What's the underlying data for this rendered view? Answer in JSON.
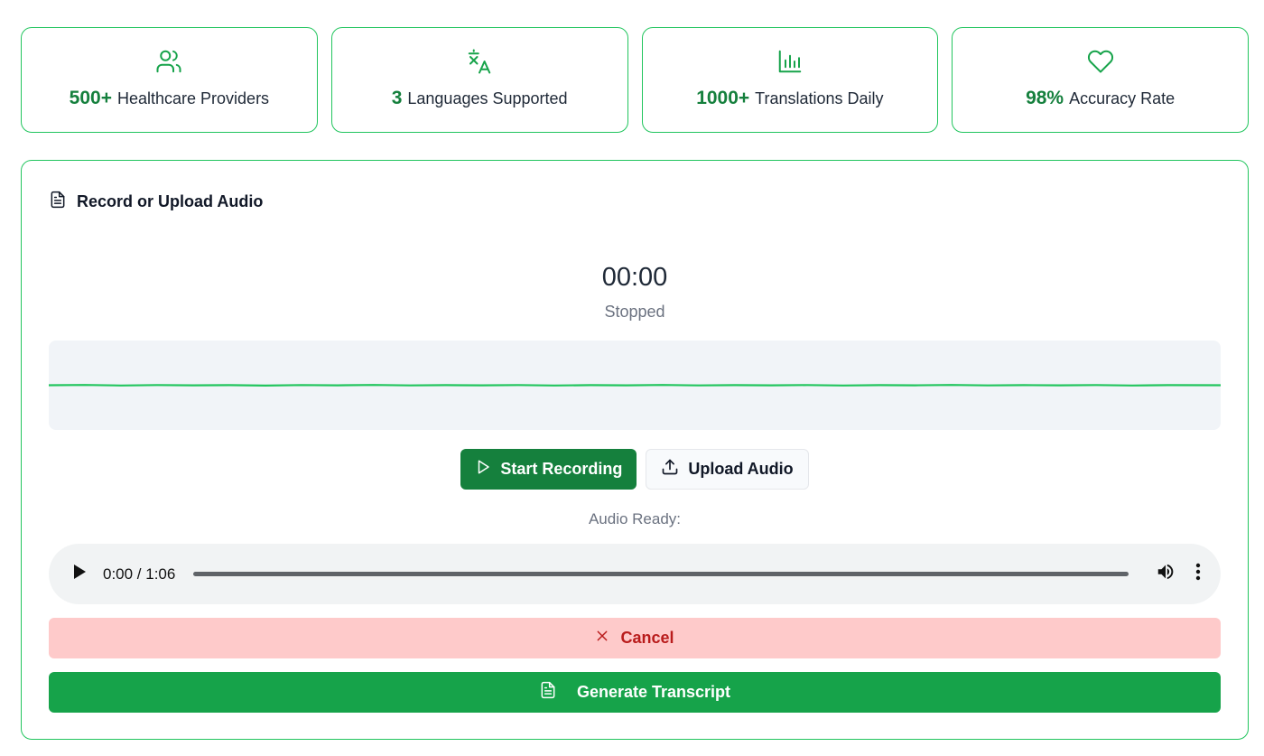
{
  "stats": [
    {
      "value": "500+",
      "label": "Healthcare Providers",
      "icon": "users-icon"
    },
    {
      "value": "3",
      "label": "Languages Supported",
      "icon": "translate-icon"
    },
    {
      "value": "1000+",
      "label": "Translations Daily",
      "icon": "bar-chart-icon"
    },
    {
      "value": "98%",
      "label": "Accuracy Rate",
      "icon": "heart-icon"
    }
  ],
  "recorder": {
    "title": "Record or Upload Audio",
    "timer": "00:00",
    "status": "Stopped",
    "start_label": "Start Recording",
    "upload_label": "Upload Audio",
    "audio_ready_label": "Audio Ready:"
  },
  "player": {
    "time": "0:00 / 1:06",
    "progress": 0
  },
  "actions": {
    "cancel_label": "Cancel",
    "generate_label": "Generate Transcript"
  },
  "colors": {
    "accent": "#16a34a",
    "accent_dark": "#15803d",
    "danger_bg": "#fecaca",
    "danger_text": "#b91c1c",
    "waveform": "#22c55e"
  }
}
